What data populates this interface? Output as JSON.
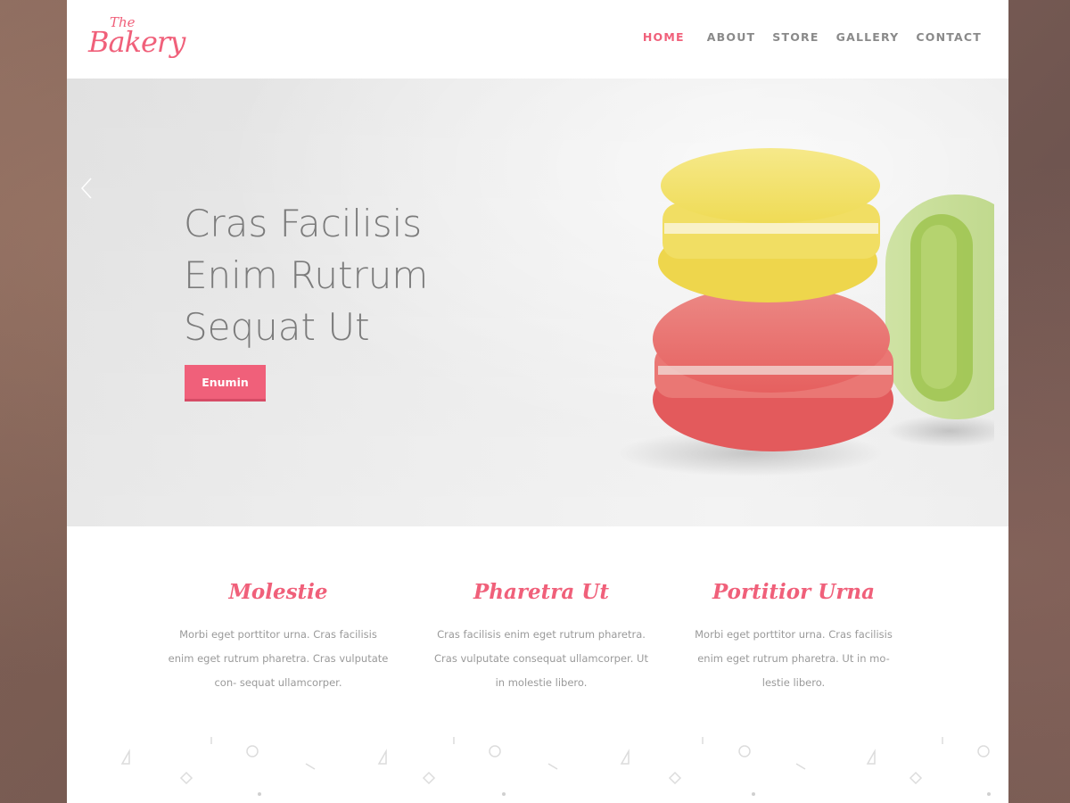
{
  "brand": {
    "the": "The",
    "name": "Bakery"
  },
  "nav": {
    "items": [
      {
        "label": "HOME",
        "active": true
      },
      {
        "label": "ABOUT",
        "active": false
      },
      {
        "label": "STORE",
        "active": false
      },
      {
        "label": "GALLERY",
        "active": false
      },
      {
        "label": "CONTACT",
        "active": false
      }
    ]
  },
  "hero": {
    "title_lines": [
      "Cras Facilisis",
      "Enim Rutrum",
      "Sequat Ut"
    ],
    "button_label": "Enumin"
  },
  "features": [
    {
      "title": "Molestie",
      "text": "Morbi eget porttitor urna. Cras facilisis enim eget rutrum pharetra. Cras vulputate con- sequat ullamcorper."
    },
    {
      "title": "Pharetra Ut",
      "text": "Cras facilisis enim eget rutrum pharetra. Cras vulputate consequat ullamcorper. Ut in molestie libero."
    },
    {
      "title": "Portitior Urna",
      "text": "Morbi eget porttitor urna. Cras facilisis enim eget rutrum pharetra.  Ut in mo- lestie libero."
    }
  ],
  "colors": {
    "accent": "#f0607a",
    "text_muted": "#9a9a9a",
    "nav_text": "#8a8a8a"
  }
}
